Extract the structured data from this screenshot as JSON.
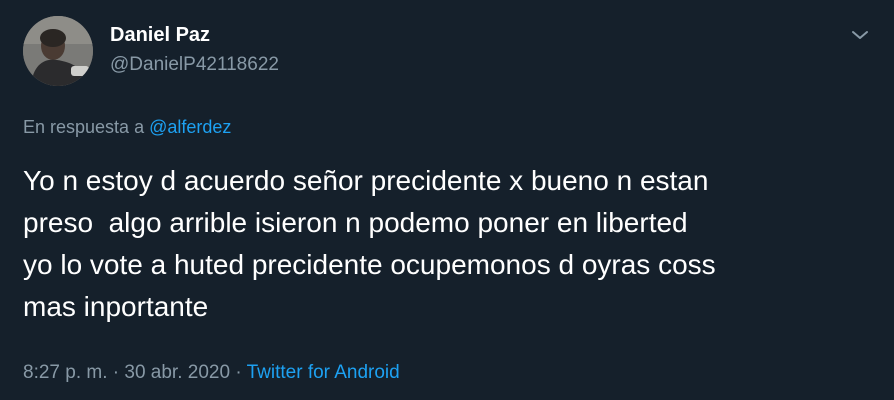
{
  "colors": {
    "background": "#15202b",
    "text": "#ffffff",
    "muted": "#8899a6",
    "accent": "#1da1f2"
  },
  "author": {
    "display_name": "Daniel Paz",
    "handle": "@DanielP42118622",
    "avatar_icon": "profile-photo"
  },
  "menu_icon": "chevron-down-icon",
  "reply": {
    "prefix": "En respuesta a ",
    "mention": "@alferdez"
  },
  "tweet": {
    "text": "Yo n estoy d acuerdo señor precidente x bueno n estan\npreso  algo arrible isieron n podemo poner en liberted\nyo lo vote a huted precidente ocupemonos d oyras coss\nmas inportante"
  },
  "meta": {
    "time": "8:27 p. m.",
    "separator": " · ",
    "date": "30 abr. 2020",
    "source": "Twitter for Android"
  }
}
